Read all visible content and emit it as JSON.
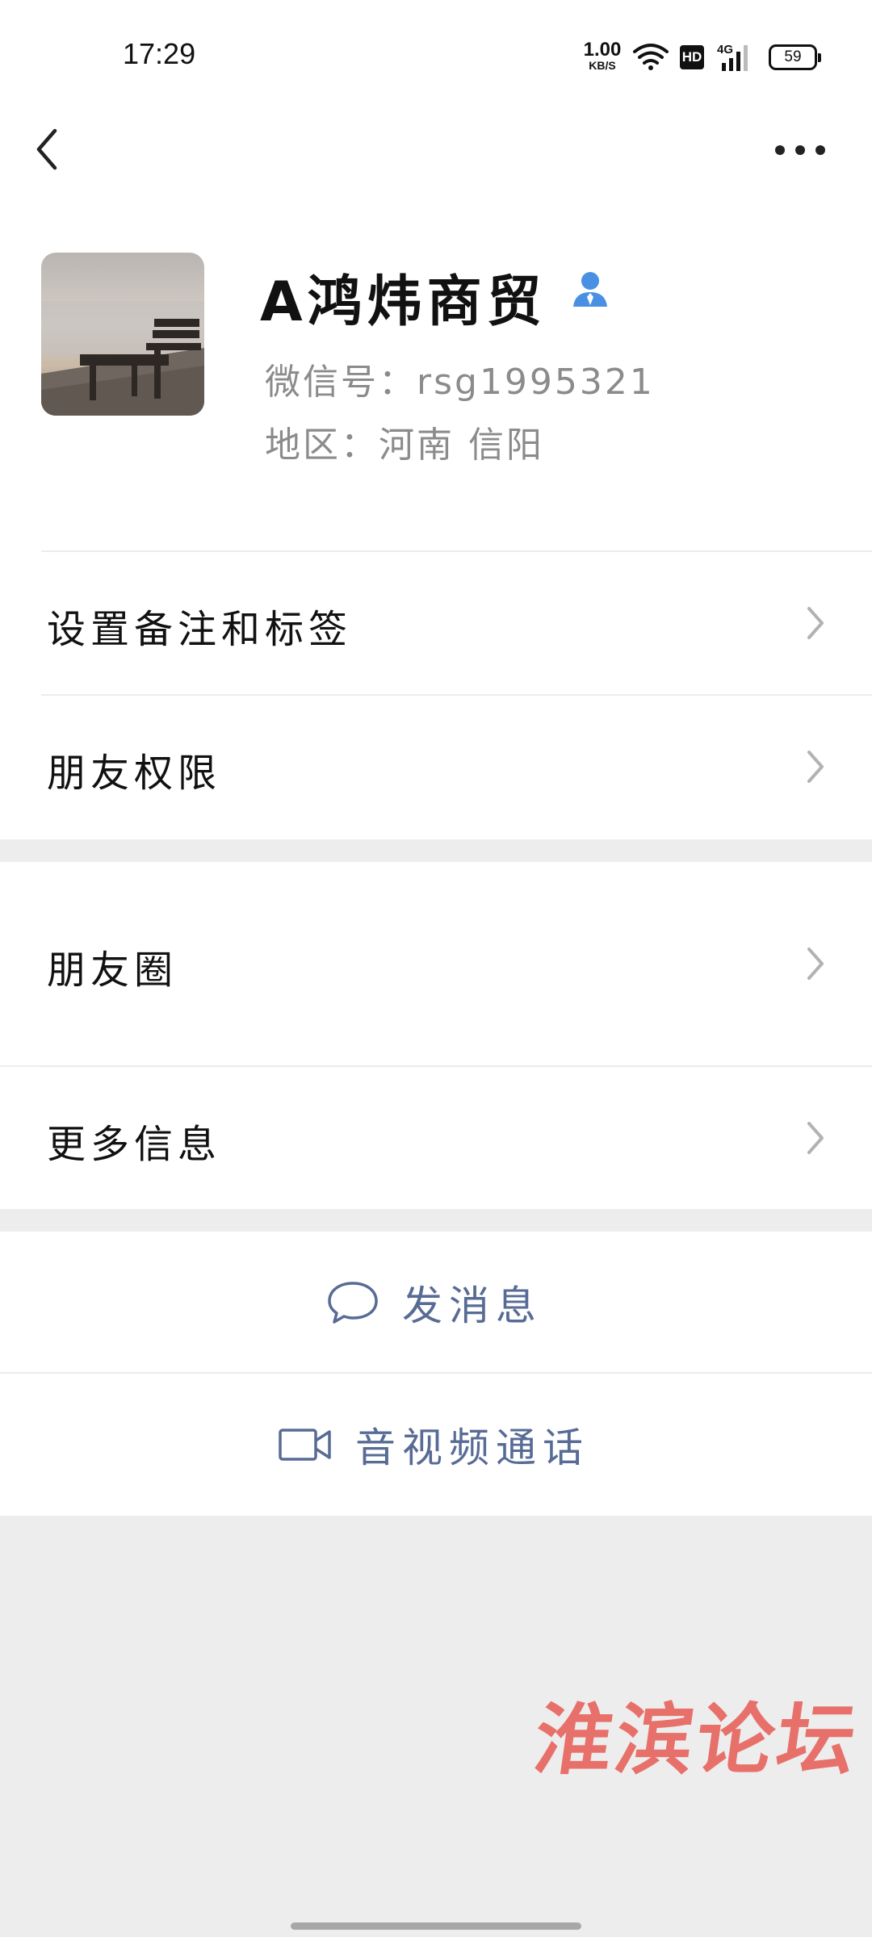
{
  "status_bar": {
    "time": "17:29",
    "net_speed_value": "1.00",
    "net_speed_unit": "KB/S",
    "hd_label": "HD",
    "network_type": "4G",
    "battery": "59"
  },
  "header": {
    "back_icon": "chevron-left-icon",
    "more_icon": "more-dots-icon"
  },
  "profile": {
    "name": "A鸿炜商贸",
    "verified_icon": "person-icon",
    "wechat_id": "微信号：rsg1995321",
    "region": "地区：河南  信阳"
  },
  "menu": {
    "group1": [
      {
        "label": "设置备注和标签"
      },
      {
        "label": "朋友权限"
      }
    ],
    "group2": [
      {
        "label": "朋友圈"
      },
      {
        "label": "更多信息"
      }
    ]
  },
  "actions": {
    "send_message": "发消息",
    "video_call": "音视频通话"
  },
  "watermark": "淮滨论坛",
  "colors": {
    "accent_link": "#576b95",
    "verified_blue": "#4a90e2",
    "background_gray": "#ededed",
    "watermark_red": "#e8706a"
  }
}
